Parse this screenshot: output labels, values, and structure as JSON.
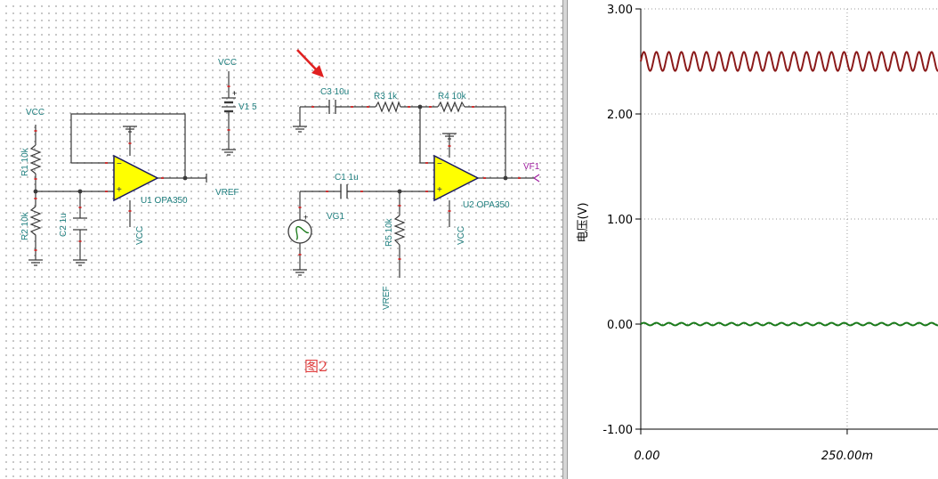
{
  "schematic": {
    "labels": {
      "vcc_r1": "VCC",
      "r1": "R1 10k",
      "r2": "R2 10k",
      "c2": "C2 1u",
      "u1": "U1 OPA350",
      "u1_vcc": "VCC",
      "vref_out": "VREF",
      "vcc_v1": "VCC",
      "v1": "V1 5",
      "c3": "C3 10u",
      "r3": "R3 1k",
      "r4": "R4 10k",
      "c1": "C1 1u",
      "vg1": "VG1",
      "r5": "R5 10k",
      "vref_r5": "VREF",
      "u2": "U2 OPA350",
      "u2_vcc": "VCC",
      "vf1": "VF1",
      "opamp_minus": "−",
      "opamp_plus": "+",
      "battery_plus": "+",
      "source_plus": "+"
    },
    "figure_caption": "图2",
    "colors": {
      "wire": "#3a3a3a",
      "label": "#1f7f7f",
      "opamp_fill": "#ffff00",
      "pin": "#cc3333",
      "arrow": "#e02020",
      "caption": "#e04040",
      "vf1": "#a020a0"
    },
    "arrow_icon": "red-arrow-pointing-at-c3"
  },
  "plot": {
    "ylabel": "电压(V)",
    "yticks": [
      "3.00",
      "2.00",
      "1.00",
      "0.00",
      "-1.00"
    ],
    "xticks": [
      "0.00",
      "250.00m"
    ]
  },
  "chart_data": {
    "type": "line",
    "ylabel": "电压(V)",
    "ylim": [
      -1.0,
      3.0
    ],
    "xlim": [
      0.0,
      0.36
    ],
    "yticks": [
      3.0,
      2.0,
      1.0,
      0.0,
      -1.0
    ],
    "xticks": [
      0.0,
      0.25
    ],
    "grid": true,
    "series": [
      {
        "color": "#8b1a1a",
        "offset": 2.5,
        "amplitude": 0.09,
        "frequency": 66,
        "x": [
          0.0,
          0.36
        ]
      },
      {
        "color": "#1a7a1a",
        "offset": 0.0,
        "amplitude": 0.012,
        "frequency": 66,
        "x": [
          0.0,
          0.36
        ]
      }
    ]
  }
}
